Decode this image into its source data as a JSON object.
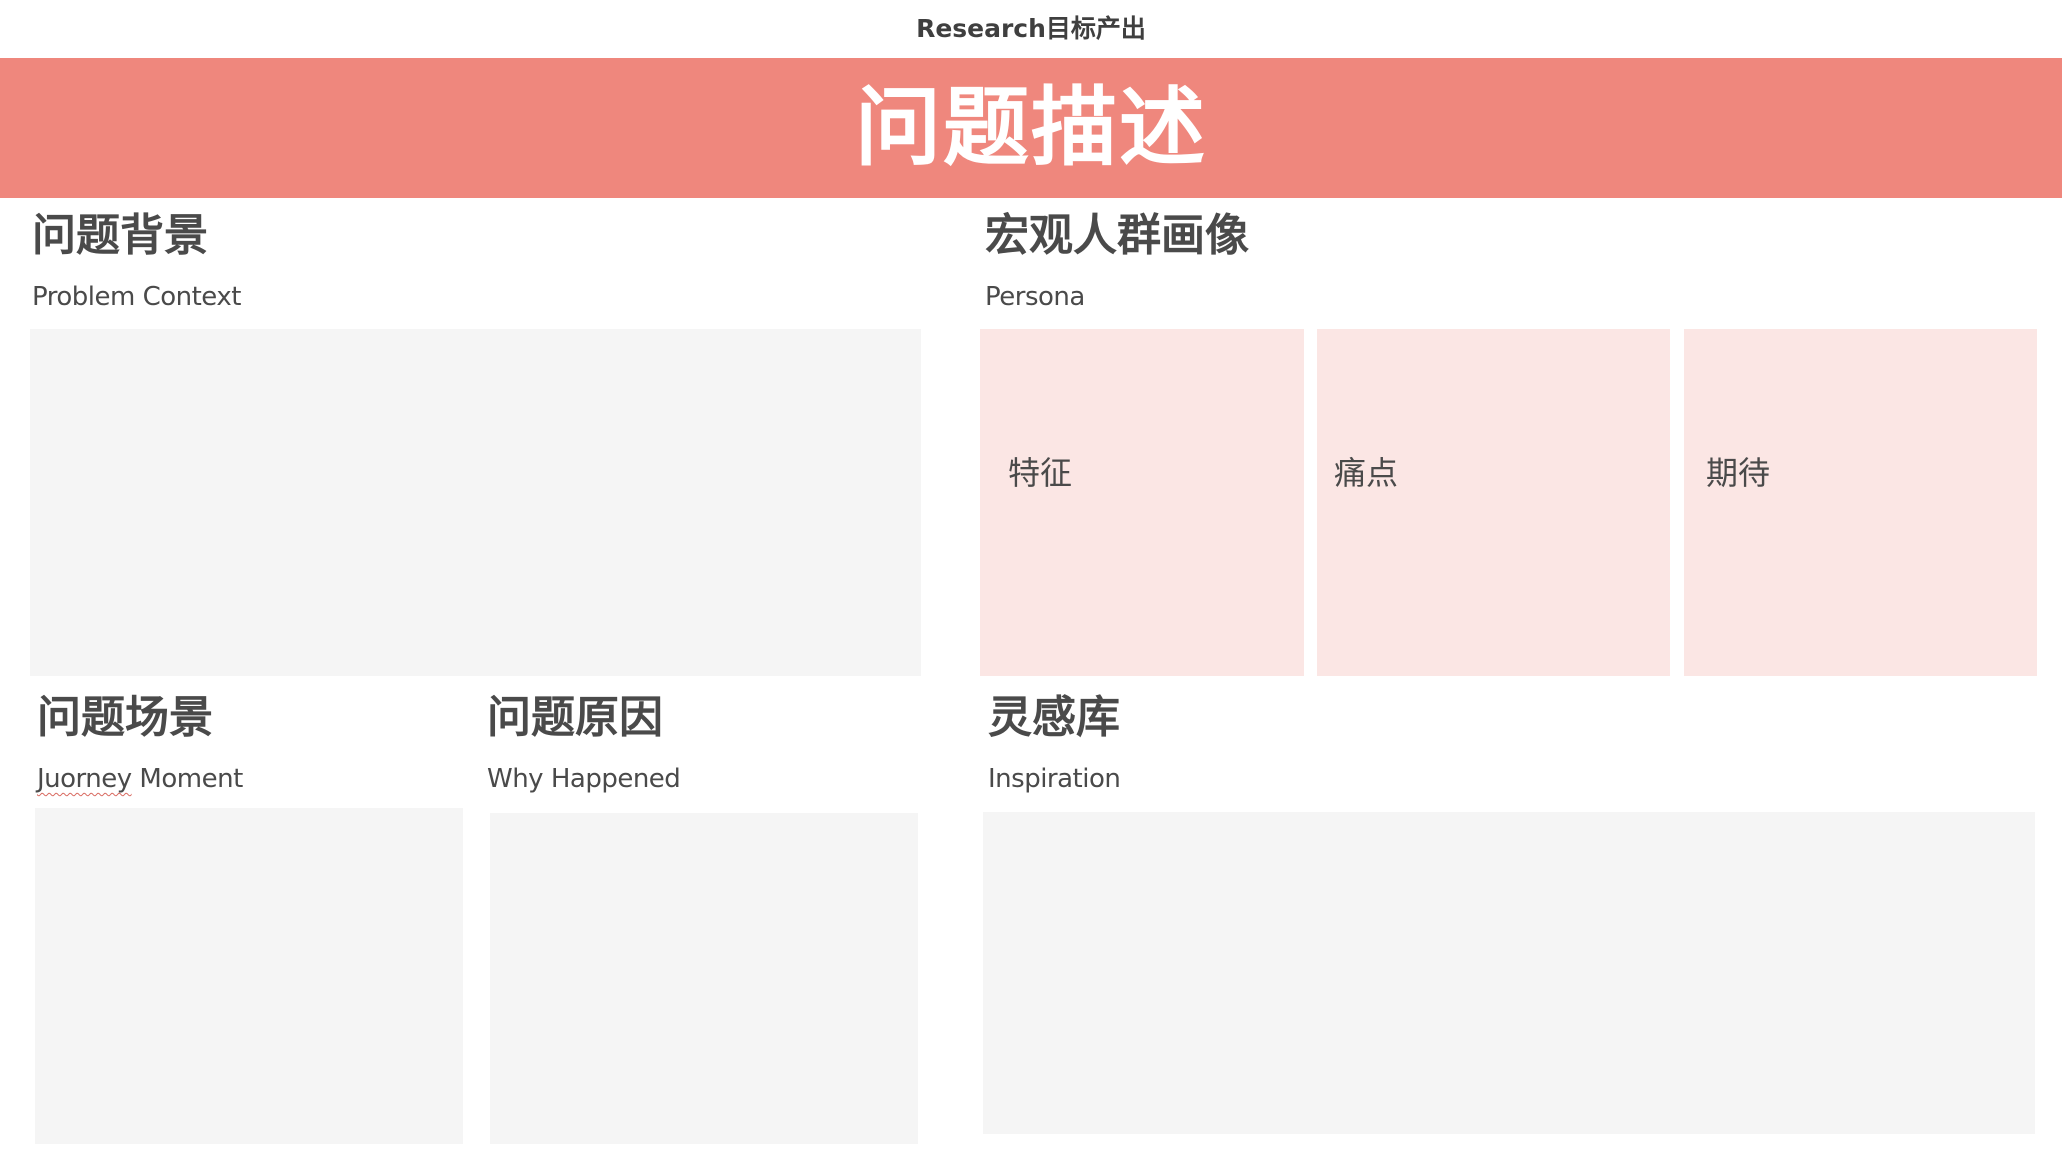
{
  "header": {
    "top_title": "Research目标产出",
    "banner_title": "问题描述"
  },
  "problem_context": {
    "title": "问题背景",
    "subtitle": "Problem Context"
  },
  "persona": {
    "title": "宏观人群画像",
    "subtitle": "Persona",
    "cards": [
      {
        "label": "特征"
      },
      {
        "label": "痛点"
      },
      {
        "label": "期待"
      }
    ]
  },
  "journey_moment": {
    "title": "问题场景",
    "subtitle_word1": "Juorney",
    "subtitle_word2": " Moment"
  },
  "why_happened": {
    "title": "问题原因",
    "subtitle": "Why Happened"
  },
  "inspiration": {
    "title": "灵感库",
    "subtitle": "Inspiration"
  },
  "colors": {
    "banner": "#ef877d",
    "panel_grey": "#f5f5f5",
    "panel_pink": "#fbe6e4",
    "text": "#4a4a4a"
  }
}
